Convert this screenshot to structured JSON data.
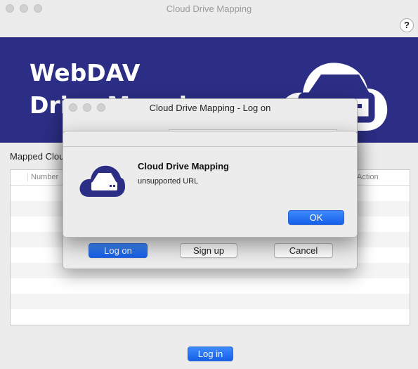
{
  "window": {
    "title": "Cloud Drive Mapping",
    "help_label": "?"
  },
  "banner": {
    "line1": "WebDAV",
    "line2": "Drive Mapping",
    "color": "#2b2e84"
  },
  "main": {
    "section_label": "Mapped Cloud Drives",
    "columns": [
      "Number",
      "Action"
    ],
    "login_button": "Log in"
  },
  "logon_dialog": {
    "title": "Cloud Drive Mapping - Log on",
    "buttons": {
      "logon": "Log on",
      "signup": "Sign up",
      "cancel": "Cancel"
    }
  },
  "alert": {
    "title": "Cloud Drive Mapping",
    "message": "unsupported URL",
    "ok_button": "OK",
    "icon": "cloud-drive-icon"
  }
}
